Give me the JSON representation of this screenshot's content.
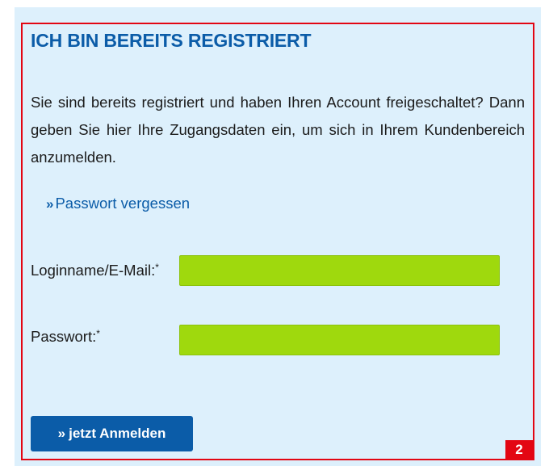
{
  "login_box": {
    "heading": "ICH BIN BEREITS REGISTRIERT",
    "intro": "Sie sind bereits registriert und haben Ihren Account freigeschaltet? Dann geben Sie hier Ihre Zugangsdaten ein, um sich in Ihrem Kundenbereich anzumelden.",
    "forgot_password": {
      "icon": "double-chevron-right-icon",
      "label": "Passwort vergessen"
    },
    "fields": {
      "login": {
        "label": "Loginname/E-Mail:",
        "required_mark": "*",
        "value": ""
      },
      "password": {
        "label": "Passwort:",
        "required_mark": "*",
        "value": ""
      }
    },
    "submit": {
      "icon": "double-chevron-right-icon",
      "label": "jetzt Anmelden"
    },
    "annotation_badge": "2"
  },
  "colors": {
    "panel_background": "#ddf0fc",
    "accent_blue": "#0b5ca8",
    "input_green": "#9fd90d",
    "highlight_red": "#e30613"
  }
}
